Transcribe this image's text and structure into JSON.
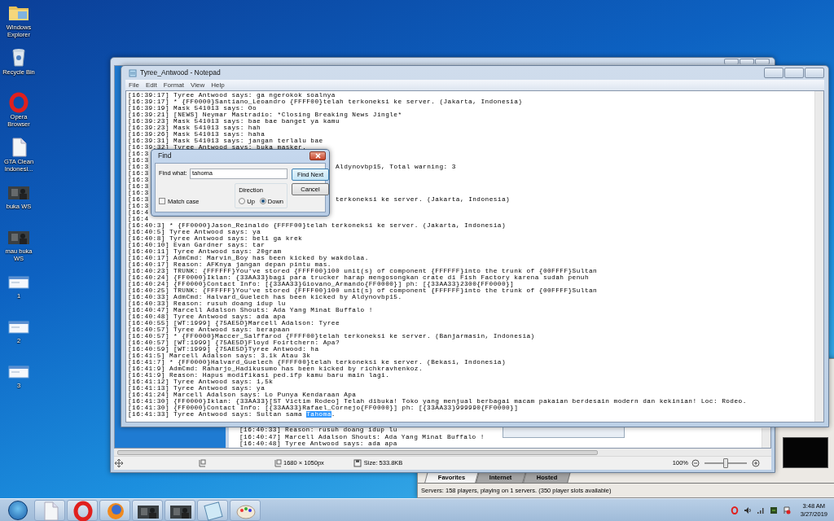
{
  "desktop_icons": [
    {
      "label": "Windows Explorer",
      "kind": "folder"
    },
    {
      "label": "Recycle Bin",
      "kind": "bin"
    },
    {
      "label": "Opera Browser",
      "kind": "opera"
    },
    {
      "label": "GTA Clean Indonesi...",
      "kind": "document"
    },
    {
      "label": "buka WS",
      "kind": "picture"
    },
    {
      "label": "mau buka WS",
      "kind": "picture"
    },
    {
      "label": "1",
      "kind": "screenshot"
    },
    {
      "label": "2",
      "kind": "screenshot"
    },
    {
      "label": "3",
      "kind": "screenshot"
    }
  ],
  "viewer": {
    "lines": [
      "[16:40:33] Reason: rusuh doang idup lu",
      "[16:40:47] Marcell Adalson Shouts: Ada Yang Minat Buffalo !",
      "[16:40:48] Tyree Antwood says: ada apa"
    ],
    "status": {
      "dimensions": "1680 × 1050px",
      "size": "Size: 533.8KB",
      "zoom": "100%",
      "level": 0.5
    }
  },
  "server_browser": {
    "tabs": [
      {
        "label": "Favorites",
        "selected": true
      },
      {
        "label": "Internet",
        "selected": false
      },
      {
        "label": "Hosted",
        "selected": false
      }
    ],
    "status": "Servers: 158 players, playing on 1 servers. (350 player slots available)"
  },
  "notepad": {
    "title": "Tyree_Antwood - Notepad",
    "menu": [
      "File",
      "Edit",
      "Format",
      "View",
      "Help"
    ],
    "lines": [
      {
        "kind": "text",
        "text": "[16:39:17] Tyree Antwood says: ga ngerokok soalnya"
      },
      {
        "kind": "text",
        "text": "[16:39:17] * {FF0000}Santiano_Leoandro {FFFF00}telah terkoneksi ke server. (Jakarta, Indonesia)"
      },
      {
        "kind": "text",
        "text": "[16:39:19] Mask 541013 says: Oo"
      },
      {
        "kind": "text",
        "text": "[16:39:21] [NEWS] Neymar Mastradio: *Closing Breaking News Jingle*"
      },
      {
        "kind": "text",
        "text": "[16:39:23] Mask 541013 says: bae bae banget ya kamu"
      },
      {
        "kind": "text",
        "text": "[16:39:23] Mask 541013 says: hah"
      },
      {
        "kind": "text",
        "text": "[16:39:26] Mask 541013 says: haha"
      },
      {
        "kind": "text",
        "text": "[16:39:31] Mask 541013 says: jangan terlalu bae"
      },
      {
        "kind": "text",
        "text": "[16:39:32] Tyree Antwood says: buka masker."
      },
      {
        "kind": "covered",
        "prefix": "[16:3"
      },
      {
        "kind": "covered",
        "prefix": "[16:3"
      },
      {
        "kind": "covered",
        "prefix": "[16:3",
        "suffix": "Aldynovbp15, Total warning: 3"
      },
      {
        "kind": "covered",
        "prefix": "[16:3"
      },
      {
        "kind": "covered",
        "prefix": "[16:3"
      },
      {
        "kind": "covered",
        "prefix": "[16:3"
      },
      {
        "kind": "covered",
        "prefix": "[16:3"
      },
      {
        "kind": "covered",
        "prefix": "[16:3",
        "suffix": "terkoneksi ke server. (Jakarta, Indonesia)"
      },
      {
        "kind": "covered",
        "prefix": "[16:3"
      },
      {
        "kind": "covered",
        "prefix": "[16:4"
      },
      {
        "kind": "covered",
        "prefix": "[16:4"
      },
      {
        "kind": "text",
        "text": "[16:40:3] * {FF0000}Jason_Reinaldo {FFFF00}telah terkoneksi ke server. (Jakarta, Indonesia)"
      },
      {
        "kind": "text",
        "text": "[16:40:5] Tyree Antwood says: ya"
      },
      {
        "kind": "text",
        "text": "[16:40:8] Tyree Antwood says: beli ga krek"
      },
      {
        "kind": "text",
        "text": "[16:40:10] Evan Gardner says: tar"
      },
      {
        "kind": "text",
        "text": "[16:40:11] Tyree Antwood says: 20gram"
      },
      {
        "kind": "text",
        "text": "[16:40:17] AdmCmd: Marvin_Boy has been kicked by wakdolaa."
      },
      {
        "kind": "text",
        "text": "[16:40:17] Reason: AFKnya jangan depan pintu mas."
      },
      {
        "kind": "text",
        "text": "[16:40:23] TRUNK: {FFFFFF}You've stored {FFFF00}100 unit(s) of component {FFFFFF}into the trunk of {00FFFF}Sultan"
      },
      {
        "kind": "text",
        "text": "[16:40:24] {FF0000}Iklan: {33AA33}bagi para trucker harap mengosongkan crate di Fish Factory karena sudah penuh"
      },
      {
        "kind": "text",
        "text": "[16:40:24] {FF0000}Contact Info: [{33AA33}Giovano_Armando{FF0000}] ph: [{33AA33}2300{FF0000}]"
      },
      {
        "kind": "text",
        "text": "[16:40:25] TRUNK: {FFFFFF}You've stored {FFFF00}100 unit(s) of component {FFFFFF}into the trunk of {00FFFF}Sultan"
      },
      {
        "kind": "text",
        "text": "[16:40:33] AdmCmd: Halvard_Guelech has been kicked by Aldynovbp15."
      },
      {
        "kind": "text",
        "text": "[16:40:33] Reason: rusuh doang idup lu"
      },
      {
        "kind": "text",
        "text": "[16:40:47] Marcell Adalson Shouts: Ada Yang Minat Buffalo !"
      },
      {
        "kind": "text",
        "text": "[16:40:48] Tyree Antwood says: ada apa"
      },
      {
        "kind": "text",
        "text": "[16:40:55] [WT:1999] {75AE5D}Marcell Adalson: Tyree"
      },
      {
        "kind": "text",
        "text": "[16:40:57] Tyree Antwood says: berapaan"
      },
      {
        "kind": "text",
        "text": "[16:40:57] * {FF0000}Maccer_Salffarod {FFFF00}telah terkoneksi ke server. (Banjarmasin, Indonesia)"
      },
      {
        "kind": "text",
        "text": "[16:40:57] [WT:1999] {75AE5D}Floyd Foirtchern: Apa?"
      },
      {
        "kind": "text",
        "text": "[16:40:59] [WT:1999] {75AE5D}Tyree Antwood: ha"
      },
      {
        "kind": "text",
        "text": "[16:41:5] Marcell Adalson says: 3.1k Atau 3k"
      },
      {
        "kind": "text",
        "text": "[16:41:7] * {FF0000}Halvard_Guelech {FFFF00}telah terkoneksi ke server. (Bekasi, Indonesia)"
      },
      {
        "kind": "text",
        "text": "[16:41:9] AdmCmd: Raharjo_Hadikusumo has been kicked by richkravhenkoz."
      },
      {
        "kind": "text",
        "text": "[16:41:9] Reason: Hapus modifikasi ped.ifp kamu baru main lagi."
      },
      {
        "kind": "text",
        "text": "[16:41:12] Tyree Antwood says: 1,5k"
      },
      {
        "kind": "text",
        "text": "[16:41:13] Tyree Antwood says: ya"
      },
      {
        "kind": "text",
        "text": "[16:41:24] Marcell Adalson says: Lo Punya Kendaraan Apa"
      },
      {
        "kind": "text",
        "text": "[16:41:30] {FF0000}Iklan: {33AA33}[ST Victim Rodeo] Telah dibuka! Toko yang menjual berbagai macam pakaian berdesain modern dan kekinian! Loc: Rodeo."
      },
      {
        "kind": "text",
        "text": "[16:41:30] {FF0000}Contact Info: [{33AA33}Rafael_Cornejo{FF0000}] ph: [{33AA33}999990{FF0000}]"
      },
      {
        "kind": "parts",
        "parts": [
          {
            "text": "[16:41:33] Tyree Antwood says: Sultan sama ",
            "selected": false
          },
          {
            "text": "Tahoma",
            "selected": true
          },
          {
            "text": ".",
            "selected": false
          }
        ]
      }
    ]
  },
  "find_dialog": {
    "title": "Find",
    "find_what_label": "Find what:",
    "value": "tahoma",
    "find_next": "Find Next",
    "cancel": "Cancel",
    "direction_label": "Direction",
    "directions": [
      {
        "label": "Up",
        "selected": false
      },
      {
        "label": "Down",
        "selected": true
      }
    ],
    "match_case": {
      "label": "Match case",
      "checked": false
    }
  },
  "taskbar": {
    "apps": [
      {
        "kind": "document"
      },
      {
        "kind": "opera"
      },
      {
        "kind": "firefox"
      },
      {
        "kind": "picture"
      },
      {
        "kind": "picture"
      },
      {
        "kind": "notepad"
      },
      {
        "kind": "paint"
      }
    ],
    "time": "3:48 AM",
    "date": "3/27/2019"
  }
}
